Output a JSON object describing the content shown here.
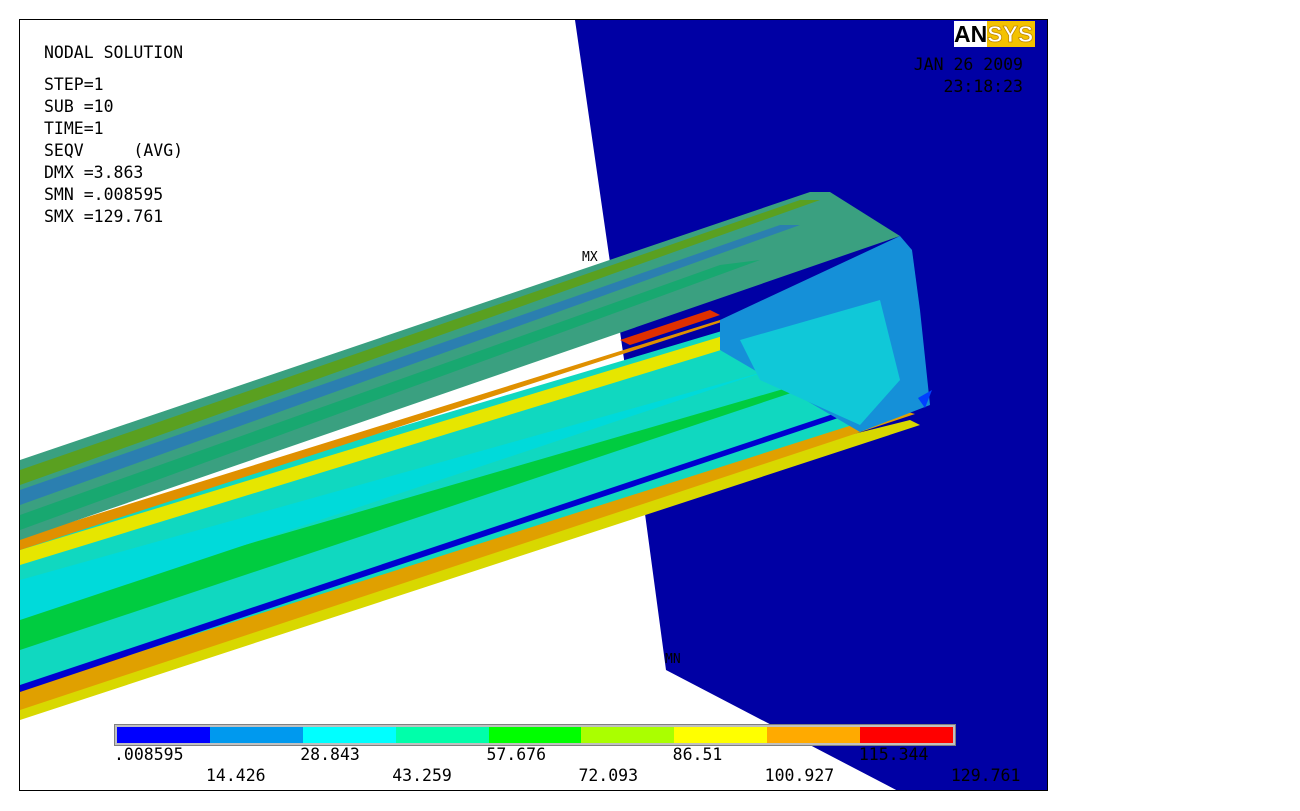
{
  "plot": {
    "title": "NODAL SOLUTION",
    "step": "STEP=1",
    "sub": "SUB =10",
    "time": "TIME=1",
    "result": "SEQV     (AVG)",
    "dmx": "DMX =3.863",
    "smn": "SMN =.008595",
    "smx": "SMX =129.761",
    "max_tag": "MX",
    "min_tag": "MN"
  },
  "brand": {
    "logo_left": "AN",
    "logo_right": "SYS"
  },
  "timestamp": {
    "date": "JAN 26 2009",
    "time": "23:18:23"
  },
  "legend": {
    "colors": [
      "#0000ff",
      "#0099ee",
      "#00ffff",
      "#00ffaa",
      "#00ff00",
      "#aaff00",
      "#ffff00",
      "#ffaa00",
      "#ff0000"
    ],
    "labels_top": [
      ".008595",
      "28.843",
      "57.676",
      "86.51",
      "115.344"
    ],
    "labels_bottom": [
      "14.426",
      "43.259",
      "72.093",
      "100.927",
      "129.761"
    ]
  },
  "colors": {
    "plate": "#0000a4",
    "background": "#ffffff"
  }
}
